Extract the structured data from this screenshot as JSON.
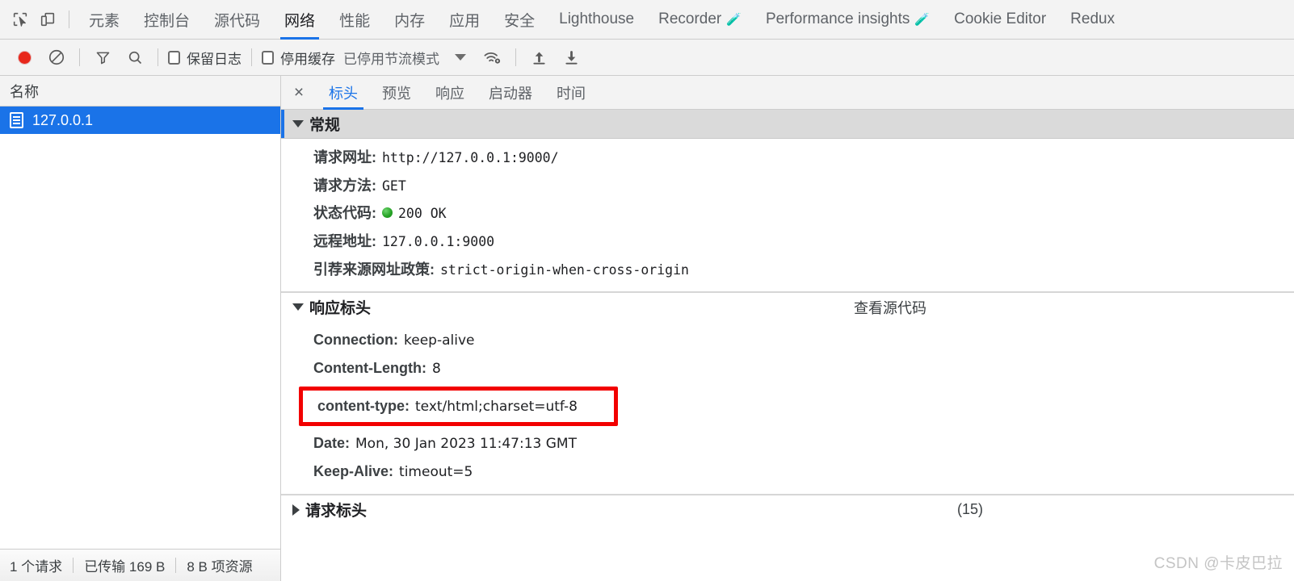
{
  "devtools": {
    "left_icons": [
      {
        "name": "inspect-element-icon",
        "glyph": "inspect"
      },
      {
        "name": "device-toolbar-icon",
        "glyph": "device"
      }
    ],
    "panel_tabs": [
      {
        "label": "元素",
        "active": false,
        "experimental": false
      },
      {
        "label": "控制台",
        "active": false,
        "experimental": false
      },
      {
        "label": "源代码",
        "active": false,
        "experimental": false
      },
      {
        "label": "网络",
        "active": true,
        "experimental": false
      },
      {
        "label": "性能",
        "active": false,
        "experimental": false
      },
      {
        "label": "内存",
        "active": false,
        "experimental": false
      },
      {
        "label": "应用",
        "active": false,
        "experimental": false
      },
      {
        "label": "安全",
        "active": false,
        "experimental": false
      },
      {
        "label": "Lighthouse",
        "active": false,
        "experimental": false
      },
      {
        "label": "Recorder",
        "active": false,
        "experimental": true
      },
      {
        "label": "Performance insights",
        "active": false,
        "experimental": true
      },
      {
        "label": "Cookie Editor",
        "active": false,
        "experimental": false
      },
      {
        "label": "Redux",
        "active": false,
        "experimental": false
      }
    ]
  },
  "network_toolbar": {
    "record_title": "record-button",
    "clear_title": "clear-button",
    "filter_title": "filter-button",
    "search_title": "search-button",
    "preserve_log_label": "保留日志",
    "disable_cache_label": "停用缓存",
    "throttling_label": "已停用节流模式",
    "network_conditions_title": "network-conditions",
    "import_title": "import-har",
    "export_title": "export-har"
  },
  "requests": {
    "column_header": "名称",
    "rows": [
      {
        "name": "127.0.0.1",
        "selected": true
      }
    ]
  },
  "status_bar": {
    "requests": "1 个请求",
    "transferred": "已传输 169 B",
    "resources": "8 B 项资源"
  },
  "detail": {
    "close_label": "×",
    "tabs": [
      {
        "label": "标头",
        "active": true
      },
      {
        "label": "预览",
        "active": false
      },
      {
        "label": "响应",
        "active": false
      },
      {
        "label": "启动器",
        "active": false
      },
      {
        "label": "时间",
        "active": false
      }
    ],
    "general": {
      "title": "常规",
      "expanded": true,
      "rows": [
        {
          "key": "请求网址:",
          "value": "http://127.0.0.1:9000/"
        },
        {
          "key": "请求方法:",
          "value": "GET"
        },
        {
          "key": "状态代码:",
          "value": "200 OK",
          "status_dot": true
        },
        {
          "key": "远程地址:",
          "value": "127.0.0.1:9000"
        },
        {
          "key": "引荐来源网址政策:",
          "value": "strict-origin-when-cross-origin"
        }
      ]
    },
    "response_headers": {
      "title": "响应标头",
      "expanded": true,
      "view_source": "查看源代码",
      "rows": [
        {
          "key": "Connection:",
          "value": "keep-alive",
          "highlight": false
        },
        {
          "key": "Content-Length:",
          "value": "8",
          "highlight": false
        },
        {
          "key": "content-type:",
          "value": "text/html;charset=utf-8",
          "highlight": true
        },
        {
          "key": "Date:",
          "value": "Mon, 30 Jan 2023 11:47:13 GMT",
          "highlight": false
        },
        {
          "key": "Keep-Alive:",
          "value": "timeout=5",
          "highlight": false
        }
      ]
    },
    "request_headers": {
      "title": "请求标头",
      "expanded": false,
      "count": "(15)"
    }
  },
  "watermark": "CSDN @卡皮巴拉",
  "colors": {
    "accent": "#1a73e8",
    "record": "#e8271b",
    "highlight_box": "#f20000",
    "status_ok": "#28a428"
  }
}
